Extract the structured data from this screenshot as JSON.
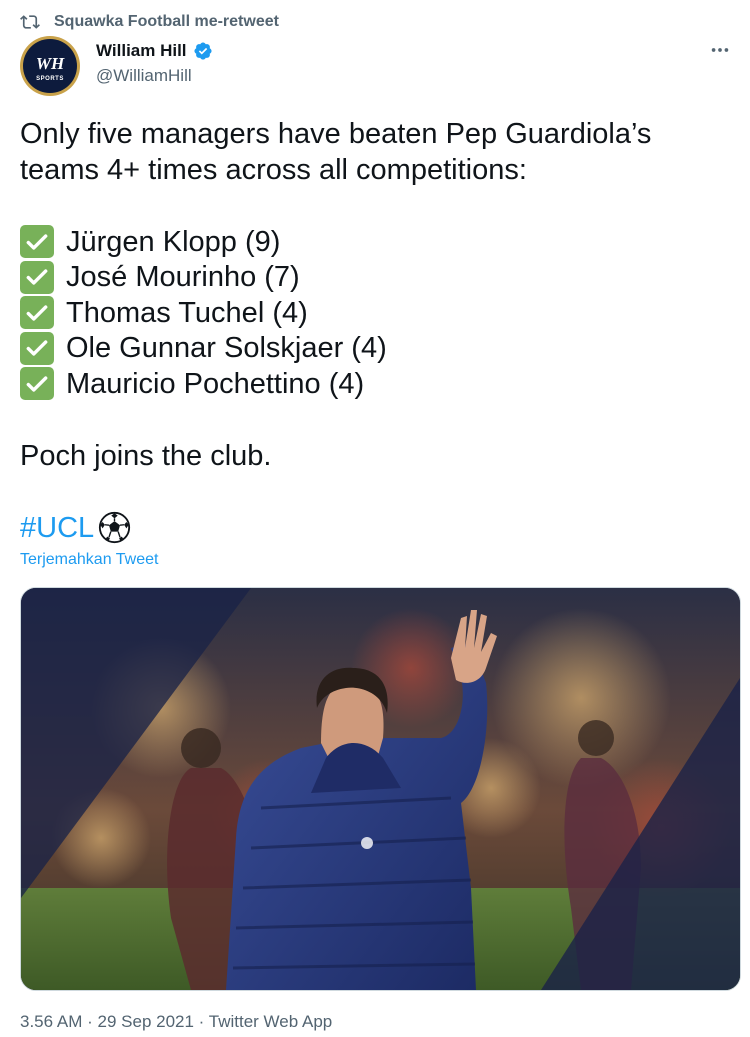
{
  "retweet": {
    "label": "Squawka Football me-retweet"
  },
  "author": {
    "name": "William Hill",
    "handle": "@WilliamHill",
    "avatar_logo": "WH",
    "avatar_sub": "SPORTS",
    "verified": true
  },
  "tweet": {
    "intro": "Only five managers have beaten Pep Guardiola’s teams 4+ times across all competitions:",
    "list": [
      "Jürgen Klopp (9)",
      "José Mourinho (7)",
      "Thomas Tuchel (4)",
      "Ole Gunnar Solskjaer (4)",
      "Mauricio Pochettino (4)"
    ],
    "closing": "Poch joins the club.",
    "hashtag": "#UCL",
    "translate_link": "Terjemahkan Tweet"
  },
  "meta": {
    "time": "3.56 AM",
    "date": "29 Sep 2021",
    "source": "Twitter Web App",
    "separator": "·"
  },
  "icons": {
    "retweet": "retweet-icon",
    "verified": "verified-badge-icon",
    "more": "more-options-icon",
    "check": "check-mark-button-emoji",
    "ball": "soccer-ball-emoji"
  },
  "colors": {
    "link": "#1d9bf0",
    "secondary_text": "#536471",
    "primary_text": "#0f1419",
    "check_green": "#78b159"
  }
}
